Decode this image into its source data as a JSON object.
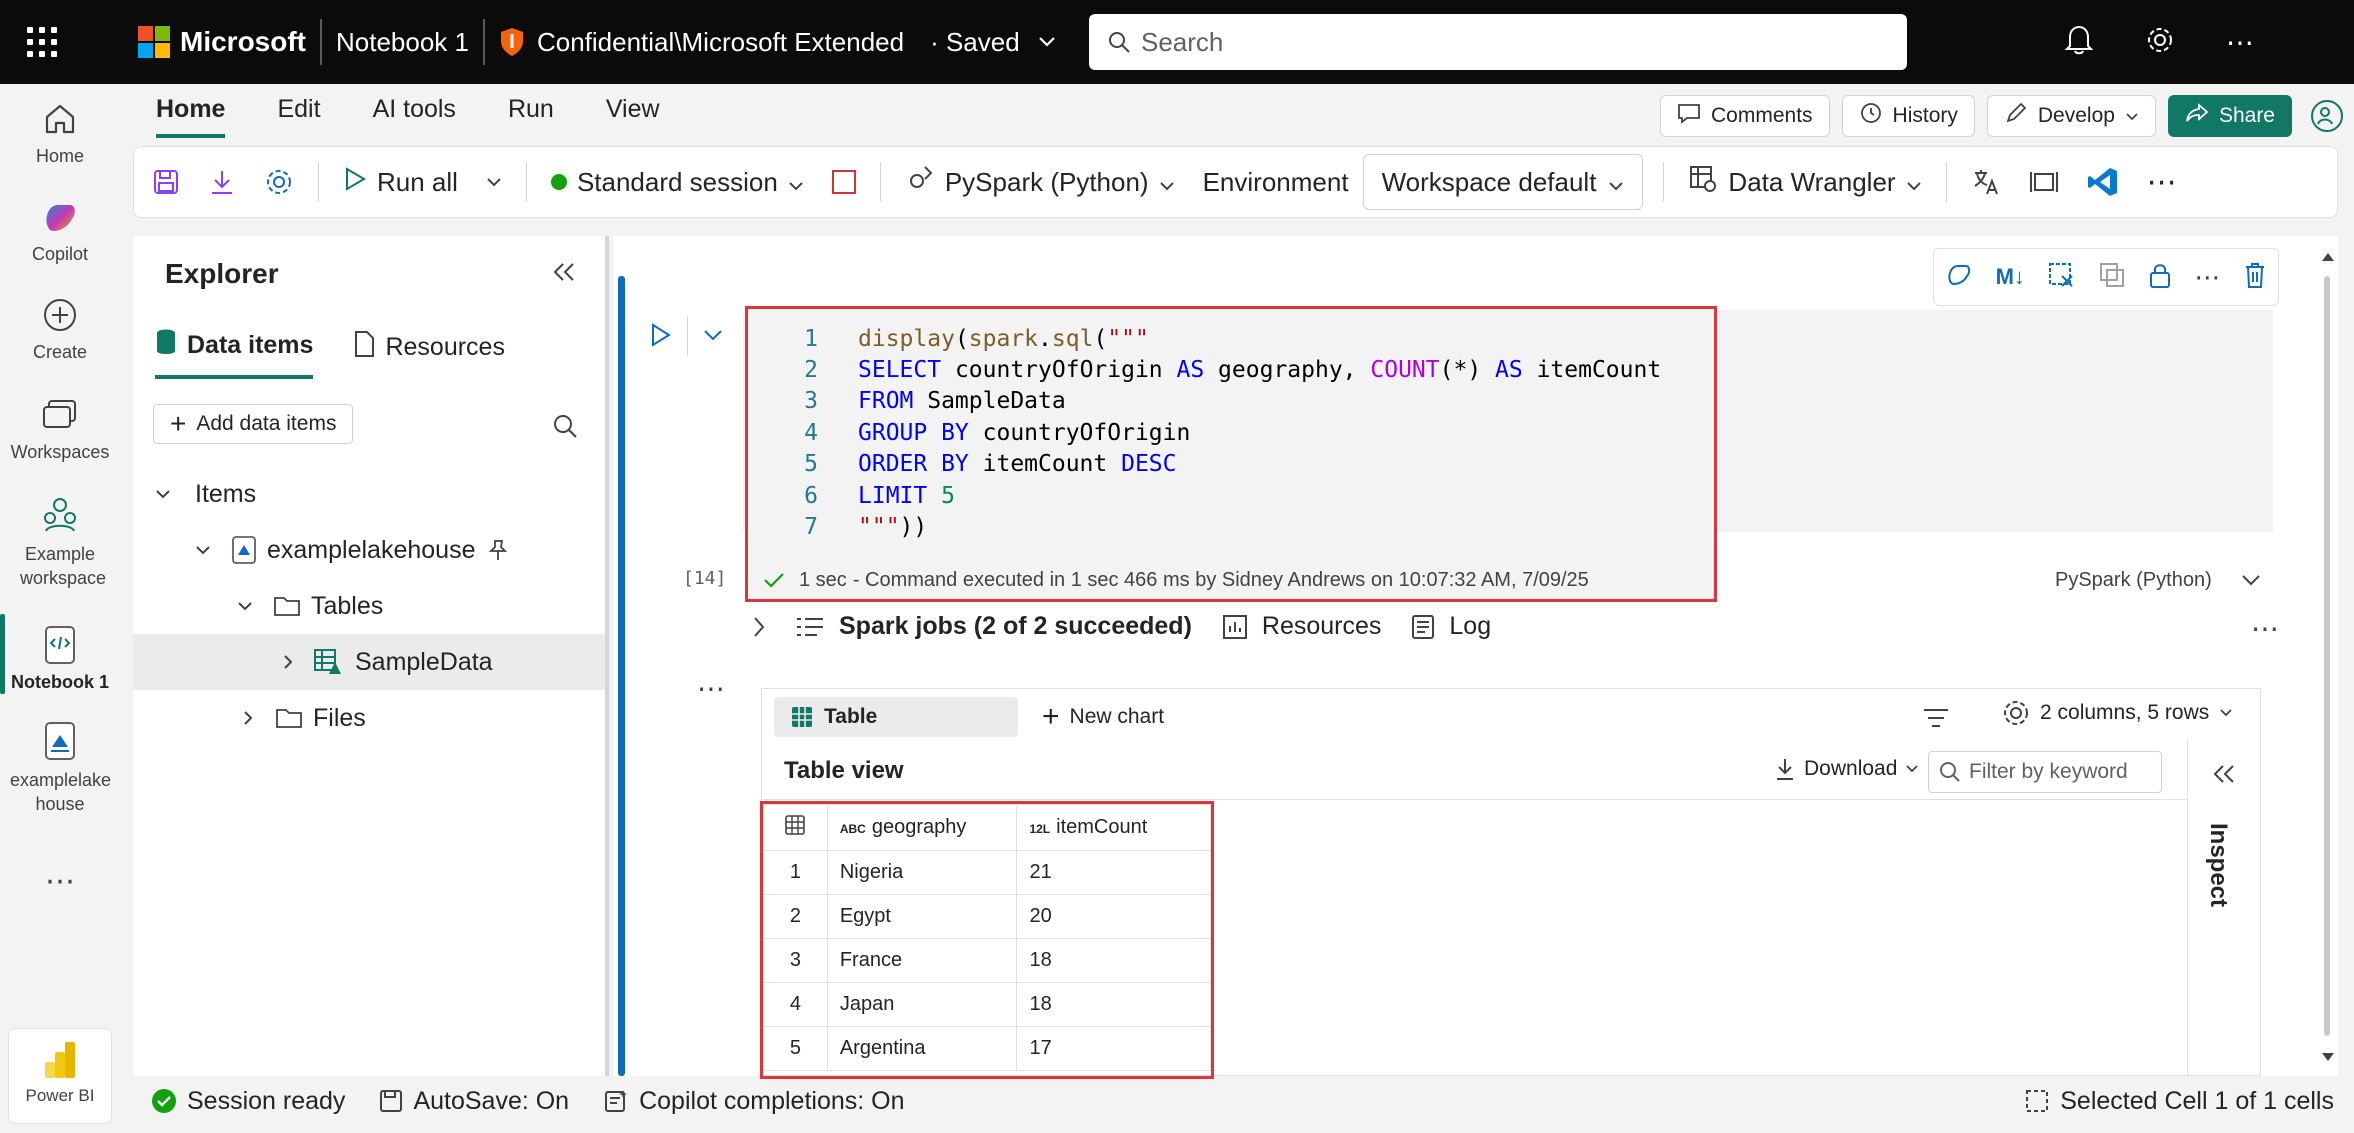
{
  "topbar": {
    "brand": "Microsoft",
    "notebook_name": "Notebook 1",
    "sensitivity": "Confidential\\Microsoft Extended",
    "save_state": "· Saved",
    "search_placeholder": "Search"
  },
  "leftrail": {
    "items": [
      {
        "label": "Home",
        "icon": "home-icon"
      },
      {
        "label": "Copilot",
        "icon": "copilot-icon"
      },
      {
        "label": "Create",
        "icon": "plus-circle-icon"
      },
      {
        "label": "Workspaces",
        "icon": "workspaces-icon"
      },
      {
        "label": "Example workspace",
        "icon": "workspace-icon"
      },
      {
        "label": "Notebook 1",
        "icon": "notebook-icon"
      },
      {
        "label": "examplelake house",
        "icon": "lakehouse-icon"
      },
      {
        "label": "Power BI",
        "icon": "powerbi-icon"
      }
    ]
  },
  "ribbon": {
    "tabs": [
      "Home",
      "Edit",
      "AI tools",
      "Run",
      "View"
    ],
    "active_tab": "Home",
    "comments": "Comments",
    "history": "History",
    "develop": "Develop",
    "share": "Share"
  },
  "toolbar": {
    "run_all": "Run all",
    "session": "Standard session",
    "language": "PySpark (Python)",
    "environment_label": "Environment",
    "environment_value": "Workspace default",
    "data_wrangler": "Data Wrangler"
  },
  "explorer": {
    "title": "Explorer",
    "tabs": [
      "Data items",
      "Resources"
    ],
    "add_button": "Add data items",
    "tree": {
      "items": "Items",
      "lakehouse": "examplelakehouse",
      "tables": "Tables",
      "table_name": "SampleData",
      "files": "Files"
    }
  },
  "cell": {
    "execution_count": "[14]",
    "code_line_numbers": [
      "1",
      "2",
      "3",
      "4",
      "5",
      "6",
      "7"
    ],
    "status_duration": "1 sec",
    "status_text": "- Command executed in 1 sec 466 ms by Sidney Andrews on 10:07:32 AM, 7/09/25",
    "language": "PySpark (Python)",
    "spark_jobs": "Spark jobs (2 of 2 succeeded)",
    "resources": "Resources",
    "log": "Log"
  },
  "output": {
    "table_tab": "Table",
    "new_chart": "New chart",
    "cols_rows": "2 columns, 5 rows",
    "table_view_title": "Table view",
    "download": "Download",
    "filter_placeholder": "Filter by keyword",
    "inspect": "Inspect",
    "columns": [
      {
        "type": "ABC",
        "name": "geography"
      },
      {
        "type": "12L",
        "name": "itemCount"
      }
    ],
    "rows": [
      {
        "idx": "1",
        "geography": "Nigeria",
        "itemCount": "21"
      },
      {
        "idx": "2",
        "geography": "Egypt",
        "itemCount": "20"
      },
      {
        "idx": "3",
        "geography": "France",
        "itemCount": "18"
      },
      {
        "idx": "4",
        "geography": "Japan",
        "itemCount": "18"
      },
      {
        "idx": "5",
        "geography": "Argentina",
        "itemCount": "17"
      }
    ]
  },
  "statusbar": {
    "session": "Session ready",
    "autosave": "AutoSave: On",
    "copilot": "Copilot completions: On",
    "selected": "Selected Cell 1 of 1 cells"
  },
  "colors": {
    "accent": "#117865",
    "highlight_border": "#d9363e",
    "cell_bar": "#0f6cbd"
  }
}
